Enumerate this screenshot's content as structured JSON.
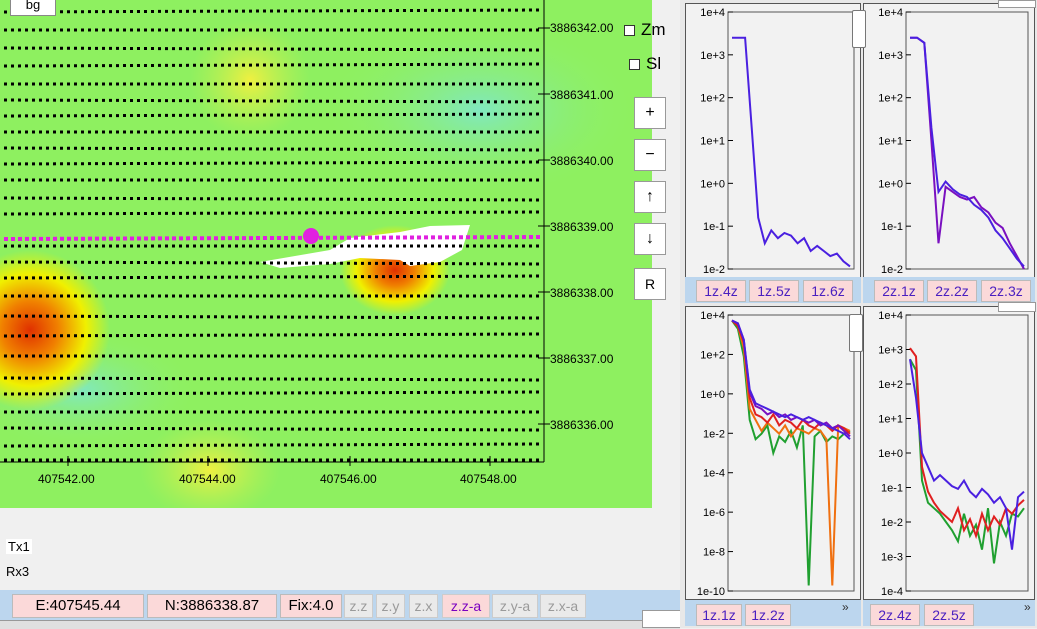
{
  "map": {
    "bg_button": "bg",
    "y_labels": [
      "3886342.00",
      "3886341.00",
      "3886340.00",
      "3886339.00",
      "3886338.00",
      "3886337.00",
      "3886336.00"
    ],
    "x_labels": [
      "407542.00",
      "407544.00",
      "407546.00",
      "407548.00"
    ],
    "zoom_in": "+",
    "zoom_out": "−",
    "up": "↑",
    "down": "↓",
    "reset": "R",
    "checks": {
      "zm": "Zm",
      "sl": "Sl"
    },
    "tx": "Tx1",
    "rx": "Rx3"
  },
  "status": {
    "easting": "E:407545.44",
    "northing": "N:3886338.87",
    "fix": "Fix:4.0",
    "buttons": [
      "z.z",
      "z.y",
      "z.x",
      "z.z-a",
      "z.y-a",
      "z.x-a"
    ]
  },
  "plots": {
    "p1": {
      "yticks": [
        "1e+4",
        "1e+3",
        "1e+2",
        "1e+1",
        "1e+0",
        "1e-1",
        "1e-2"
      ],
      "tabs": [
        "1z.4z",
        "1z.5z",
        "1z.6z"
      ]
    },
    "p2": {
      "yticks": [
        "1e+4",
        "1e+3",
        "1e+2",
        "1e+1",
        "1e+0",
        "1e-1",
        "1e-2"
      ],
      "tabs": [
        "2z.1z",
        "2z.2z",
        "2z.3z"
      ]
    },
    "p3": {
      "yticks": [
        "1e+4",
        "1e+2",
        "1e+0",
        "1e-2",
        "1e-4",
        "1e-6",
        "1e-8",
        "1e-10"
      ],
      "tabs": [
        "1z.1z",
        "1z.2z"
      ],
      "more": "»"
    },
    "p4": {
      "yticks": [
        "1e+4",
        "1e+3",
        "1e+2",
        "1e+1",
        "1e+0",
        "1e-1",
        "1e-2",
        "1e-3",
        "1e-4"
      ],
      "tabs": [
        "2z.4z",
        "2z.5z"
      ],
      "more": "»"
    }
  },
  "colors": {
    "series_blue": "#4a20e0",
    "series_purple": "#7a10c0",
    "series_red": "#e02020",
    "series_green": "#20a030",
    "series_orange": "#f07010",
    "survey_line": "#e020e0"
  }
}
